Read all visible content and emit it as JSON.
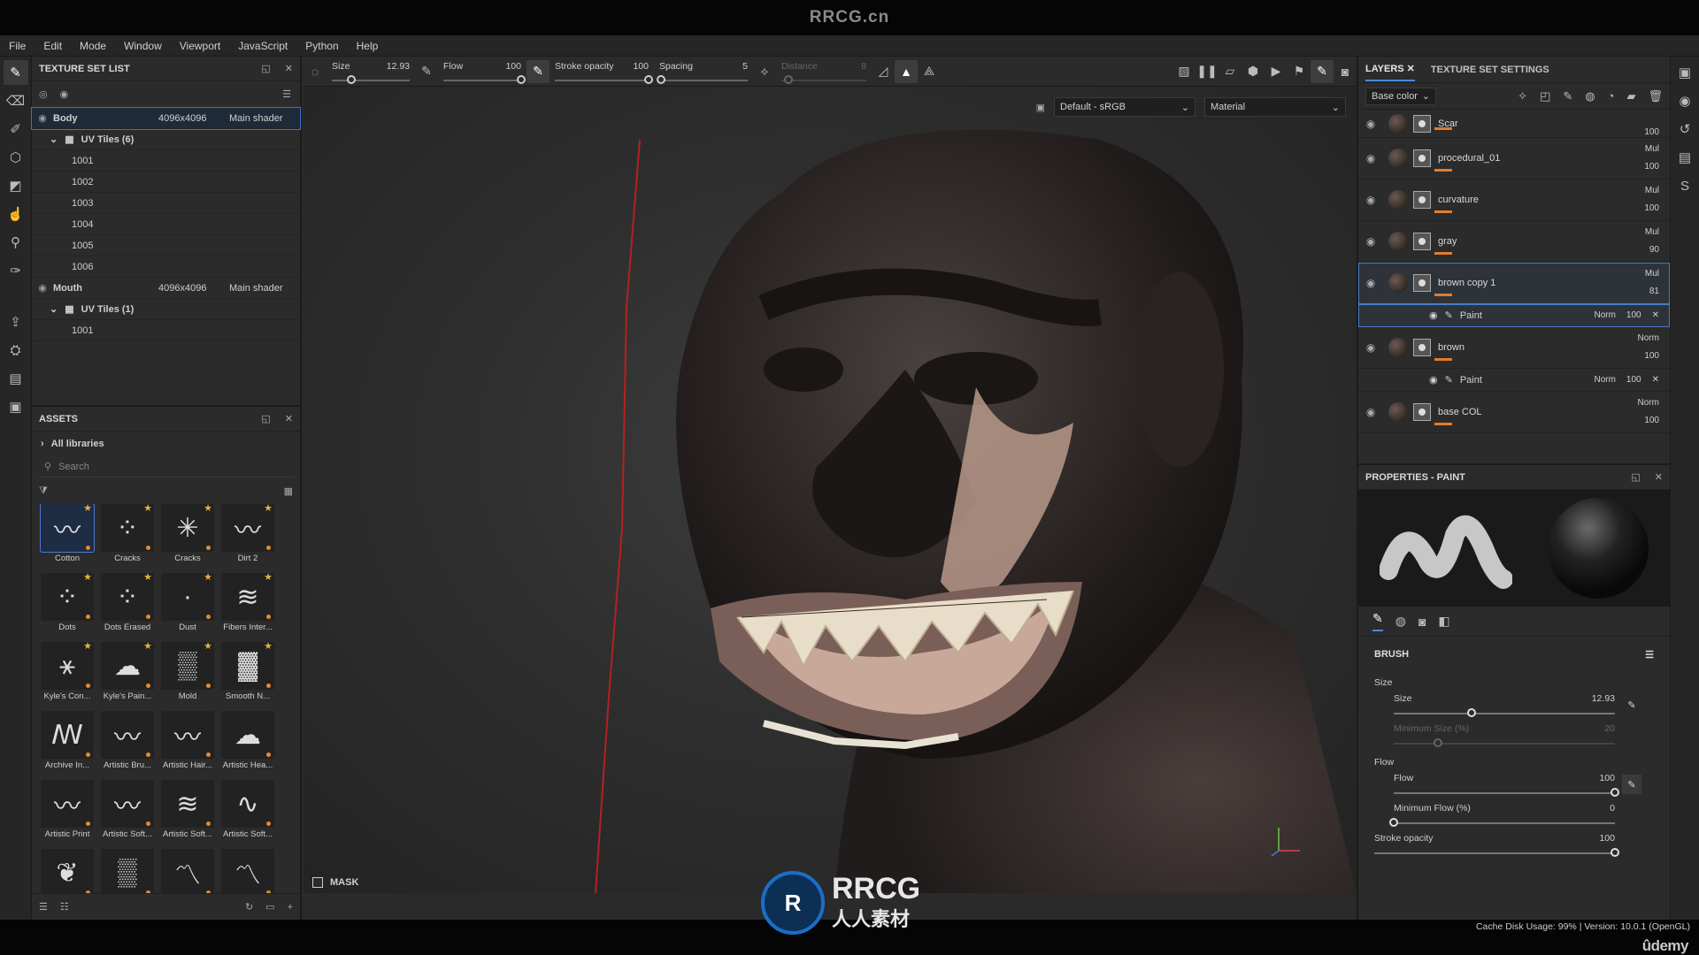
{
  "watermark_top": "RRCG.cn",
  "menu": [
    "File",
    "Edit",
    "Mode",
    "Window",
    "Viewport",
    "JavaScript",
    "Python",
    "Help"
  ],
  "texture_set_list": {
    "title": "TEXTURE SET LIST",
    "sets": [
      {
        "name": "Body",
        "resolution": "4096x4096",
        "shader": "Main shader",
        "uv_label": "UV Tiles (6)",
        "tiles": [
          "1001",
          "1002",
          "1003",
          "1004",
          "1005",
          "1006"
        ]
      },
      {
        "name": "Mouth",
        "resolution": "4096x4096",
        "shader": "Main shader",
        "uv_label": "UV Tiles (1)",
        "tiles": [
          "1001"
        ]
      }
    ]
  },
  "assets": {
    "title": "ASSETS",
    "nav": "All libraries",
    "search_placeholder": "Search",
    "items": [
      {
        "label": "Cotton",
        "selected": true
      },
      {
        "label": "Cracks"
      },
      {
        "label": "Cracks"
      },
      {
        "label": "Dirt 2"
      },
      {
        "label": "Dots"
      },
      {
        "label": "Dots Erased"
      },
      {
        "label": "Dust"
      },
      {
        "label": "Fibers Inter..."
      },
      {
        "label": "Kyle's Con..."
      },
      {
        "label": "Kyle's Pain..."
      },
      {
        "label": "Mold"
      },
      {
        "label": "Smooth N..."
      },
      {
        "label": "Archive In..."
      },
      {
        "label": "Artistic Bru..."
      },
      {
        "label": "Artistic Hair..."
      },
      {
        "label": "Artistic Hea..."
      },
      {
        "label": "Artistic Print"
      },
      {
        "label": "Artistic Soft..."
      },
      {
        "label": "Artistic Soft..."
      },
      {
        "label": "Artistic Soft..."
      },
      {
        "label": ""
      },
      {
        "label": ""
      },
      {
        "label": ""
      },
      {
        "label": ""
      }
    ]
  },
  "context_bar": {
    "size_label": "Size",
    "size_value": "12.93",
    "size_level": 0.25,
    "flow_label": "Flow",
    "flow_value": "100",
    "flow_level": 1.0,
    "opacity_label": "Stroke opacity",
    "opacity_value": "100",
    "opacity_level": 1.0,
    "spacing_label": "Spacing",
    "spacing_value": "5",
    "spacing_level": 0.02,
    "distance_label": "Distance",
    "distance_value": "8",
    "distance_level": 0.08
  },
  "viewport": {
    "colorspace": "Default - sRGB",
    "mode": "Material",
    "mask_label": "MASK"
  },
  "layers": {
    "tab_label": "LAYERS",
    "tab2_label": "TEXTURE SET SETTINGS",
    "channel": "Base color",
    "items": [
      {
        "name": "Scar",
        "blend": "",
        "opacity": "100",
        "partial": true
      },
      {
        "name": "procedural_01",
        "blend": "Mul",
        "opacity": "100"
      },
      {
        "name": "curvature",
        "blend": "Mul",
        "opacity": "100"
      },
      {
        "name": "gray",
        "blend": "Mul",
        "opacity": "90"
      },
      {
        "name": "brown copy 1",
        "blend": "Mul",
        "opacity": "81",
        "selected": true,
        "sub": {
          "name": "Paint",
          "blend": "Norm",
          "opacity": "100"
        }
      },
      {
        "name": "brown",
        "blend": "Norm",
        "opacity": "100",
        "sub": {
          "name": "Paint",
          "blend": "Norm",
          "opacity": "100"
        }
      },
      {
        "name": "base COL",
        "blend": "Norm",
        "opacity": "100"
      }
    ]
  },
  "properties": {
    "title": "PROPERTIES - PAINT",
    "section": "BRUSH",
    "size_group": "Size",
    "size_label": "Size",
    "size_value": "12.93",
    "size_level": 0.35,
    "min_size_label": "Minimum Size (%)",
    "min_size_value": "20",
    "min_size_level": 0.2,
    "flow_group": "Flow",
    "flow_label": "Flow",
    "flow_value": "100",
    "flow_level": 1.0,
    "min_flow_label": "Minimum Flow (%)",
    "min_flow_value": "0",
    "min_flow_level": 0.0,
    "stroke_opacity_label": "Stroke opacity",
    "stroke_opacity_value": "100",
    "stroke_opacity_level": 1.0
  },
  "status": {
    "text": "Cache Disk Usage:   99% | Version: 10.0.1 (OpenGL)",
    "brand": "ûdemy"
  },
  "logo": {
    "line1": "RRCG",
    "line2": "人人素材"
  },
  "colors": {
    "accent": "#4a8ad8",
    "layer_bar": "#e07d2f",
    "star": "#e5b23a"
  }
}
